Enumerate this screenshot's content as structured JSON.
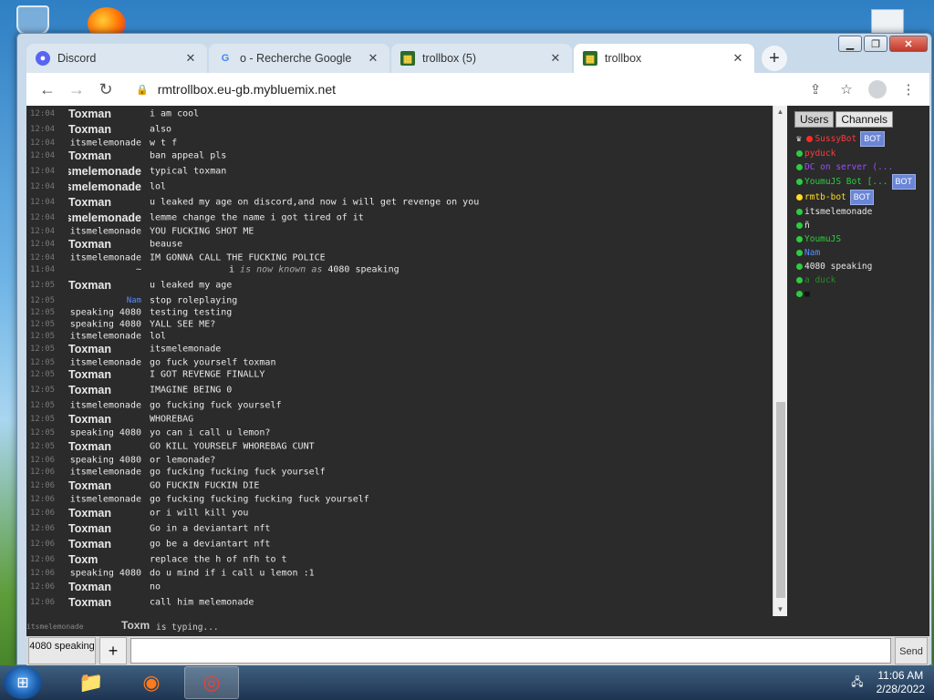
{
  "browser": {
    "tabs": [
      {
        "label": "Discord",
        "icon": "discord-icon",
        "active": false
      },
      {
        "label": "o - Recherche Google",
        "icon": "google-icon",
        "active": false
      },
      {
        "label": "trollbox (5)",
        "icon": "trollbox-icon",
        "active": false
      },
      {
        "label": "trollbox",
        "icon": "trollbox-icon",
        "active": true
      }
    ],
    "url": "rmtrollbox.eu-gb.mybluemix.net"
  },
  "chat": {
    "messages": [
      {
        "time": "12:04",
        "nick": "Toxman",
        "big": true,
        "text": "i am cool",
        "h": 17
      },
      {
        "time": "12:04",
        "nick": "Toxman",
        "big": true,
        "text": "also",
        "h": 17
      },
      {
        "time": "12:04",
        "nick": "itsmelemonade",
        "text": "w           t                   f",
        "h": 13
      },
      {
        "time": "12:04",
        "nick": "Toxman",
        "big": true,
        "text": "ban appeal pls",
        "h": 16
      },
      {
        "time": "12:04",
        "nick": "itsmelemonade",
        "big": true,
        "text": "typical toxman",
        "h": 17
      },
      {
        "time": "12:04",
        "nick": "itsmelemonade",
        "big": true,
        "text": "lol",
        "h": 17
      },
      {
        "time": "12:04",
        "nick": "Toxman",
        "big": true,
        "text": "u leaked my age on discord,and now i will get revenge on you",
        "h": 17
      },
      {
        "time": "12:04",
        "nick": "itsmelemonade",
        "big": true,
        "text": "lemme change the name i got tired of it",
        "h": 17
      },
      {
        "time": "12:04",
        "nick": "itsmelemonade",
        "text": "YOU FUCKING SHOT ME",
        "h": 13
      },
      {
        "time": "12:04",
        "nick": "Toxman",
        "big": true,
        "text": "beause",
        "h": 16
      },
      {
        "time": "12:04",
        "nick": "itsmelemonade",
        "text": "IM GONNA CALL THE FUCKING POLICE",
        "h": 13
      },
      {
        "time": "11:04",
        "nick": "~",
        "system": true,
        "prefix": "i",
        "text": "is now known as",
        "new": "4080 speaking",
        "h": 13
      },
      {
        "time": "12:05",
        "nick": "Toxman",
        "big": true,
        "text": "u leaked my age",
        "h": 21
      },
      {
        "time": "12:05",
        "nick": "Nam",
        "blue": true,
        "text": "stop roleplaying",
        "h": 13
      },
      {
        "time": "12:05",
        "nick": "4080 speaking",
        "text": "testing testing",
        "h": 13
      },
      {
        "time": "12:05",
        "nick": "4080 speaking",
        "text": "YALL SEE ME?",
        "h": 13
      },
      {
        "time": "12:05",
        "nick": "itsmelemonade",
        "text": "lol",
        "h": 13
      },
      {
        "time": "12:05",
        "nick": "Toxman",
        "big": true,
        "text": "itsmelemonade",
        "h": 16
      },
      {
        "time": "12:05",
        "nick": "itsmelemonade",
        "text": "go fuck yourself toxman",
        "h": 13
      },
      {
        "time": "12:05",
        "nick": "Toxman",
        "big": true,
        "text": "I GOT REVENGE FINALLY",
        "h": 13
      },
      {
        "time": "12:05",
        "nick": "Toxman",
        "big": true,
        "text": "IMAGINE BEING 0",
        "h": 21
      },
      {
        "time": "12:05",
        "nick": "itsmelemonade",
        "text": "go fucking fuck yourself",
        "h": 13
      },
      {
        "time": "12:05",
        "nick": "Toxman",
        "big": true,
        "text": "WHOREBAG",
        "h": 17
      },
      {
        "time": "12:05",
        "nick": "4080 speaking",
        "text": "yo can i call u lemon?",
        "h": 13
      },
      {
        "time": "12:05",
        "nick": "Toxman",
        "big": true,
        "text": "GO KILL YOURSELF WHOREBAG CUNT",
        "h": 17
      },
      {
        "time": "12:06",
        "nick": "4080 speaking",
        "text": "or lemonade?",
        "h": 13
      },
      {
        "time": "12:06",
        "nick": "itsmelemonade",
        "text": "go fucking fucking fuck yourself",
        "h": 13
      },
      {
        "time": "12:06",
        "nick": "Toxman",
        "big": true,
        "text": "GO FUCKIN FUCKIN DIE",
        "h": 17
      },
      {
        "time": "12:06",
        "nick": "itsmelemonade",
        "text": "go fucking fucking fucking fuck yourself",
        "h": 13
      },
      {
        "time": "12:06",
        "nick": "Toxman",
        "big": true,
        "text": "or i will kill you",
        "h": 17
      },
      {
        "time": "12:06",
        "nick": "Toxman",
        "big": true,
        "text": "Go in a deviantart nft",
        "h": 17
      },
      {
        "time": "12:06",
        "nick": "Toxman",
        "big": true,
        "text": "go be a deviantart nft",
        "h": 17
      },
      {
        "time": "12:06",
        "nick": "Toxm",
        "big": true,
        "text": "replace the h of nfh to t",
        "h": 17
      },
      {
        "time": "12:06",
        "nick": "4080 speaking",
        "text": "do u mind if i call u lemon :1",
        "h": 13
      },
      {
        "time": "12:06",
        "nick": "Toxman",
        "big": true,
        "text": "no",
        "h": 17
      },
      {
        "time": "12:06",
        "nick": "Toxman",
        "big": true,
        "text": "call him melemonade",
        "h": 17
      }
    ],
    "typing": {
      "nick1": "itsmelemonade",
      "nick2": "Toxm",
      "text": "is typing..."
    }
  },
  "sidebar": {
    "tabs": [
      "Users",
      "Channels"
    ],
    "users": [
      {
        "prefix": "♛ ",
        "dot": "#ff2a2a",
        "name": "SussyBot",
        "color": "#ff3b3b",
        "bot": "BOT"
      },
      {
        "dot": "#2ecc40",
        "name": "pyduck",
        "color": "#ff3b3b"
      },
      {
        "dot": "#2ecc40",
        "name": "DC on server (...",
        "color": "#9b4dff"
      },
      {
        "dot": "#2ecc40",
        "name": "YoumuJS Bot [...",
        "color": "#2ecc40",
        "bot": "BOT"
      },
      {
        "dot": "#ffdd22",
        "name": "rmtb-bot",
        "color": "#ffdd22",
        "bot": "BOT"
      },
      {
        "dot": "#2ecc40",
        "name": "itsmelemonade",
        "color": "#e8e8e8"
      },
      {
        "dot": "#2ecc40",
        "name": "ñ",
        "color": "#e8e8e8"
      },
      {
        "dot": "#2ecc40",
        "name": "YoumuJS",
        "color": "#2ecc40"
      },
      {
        "dot": "#2ecc40",
        "name": "Nam",
        "color": "#5b8cff"
      },
      {
        "dot": "#2ecc40",
        "name": "4080 speaking",
        "color": "#e8e8e8"
      },
      {
        "dot": "#2ecc40",
        "name": "a duck",
        "color": "#2a8a2a"
      },
      {
        "dot": "#2ecc40",
        "name": "■",
        "color": "#111111"
      }
    ]
  },
  "input": {
    "nick_button": "4080 speaking",
    "add_button": "+",
    "send_button": "Send"
  },
  "taskbar": {
    "time": "11:06 AM",
    "date": "2/28/2022"
  }
}
